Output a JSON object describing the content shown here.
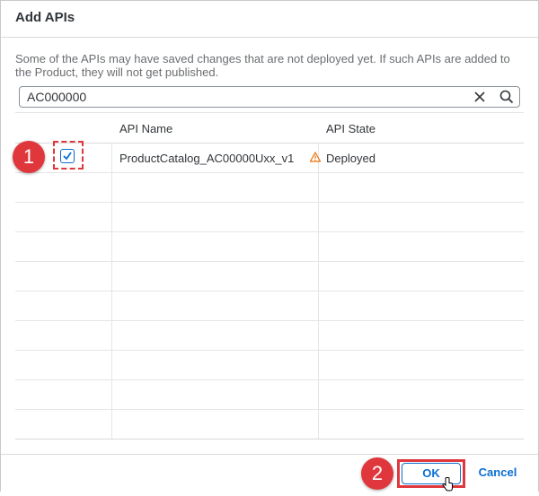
{
  "dialog": {
    "title": "Add APIs",
    "info_text": "Some of the APIs may have saved changes that are not deployed yet. If such APIs are added to the Product, they will not get published."
  },
  "search": {
    "value": "AC000000",
    "clear_icon": "close-icon",
    "search_icon": "search-icon"
  },
  "table": {
    "columns": [
      "",
      "API Name",
      "API State"
    ],
    "rows": [
      {
        "selected": true,
        "api_name": "ProductCatalog_AC00000Uxx_v1",
        "warning_icon": "warning-icon",
        "api_state": "Deployed"
      }
    ]
  },
  "footer": {
    "ok_label": "OK",
    "cancel_label": "Cancel"
  },
  "callouts": {
    "step1": "1",
    "step2": "2"
  },
  "colors": {
    "accent": "#0a6ed1",
    "highlight": "#e0373c",
    "warning": "#e9730c"
  }
}
